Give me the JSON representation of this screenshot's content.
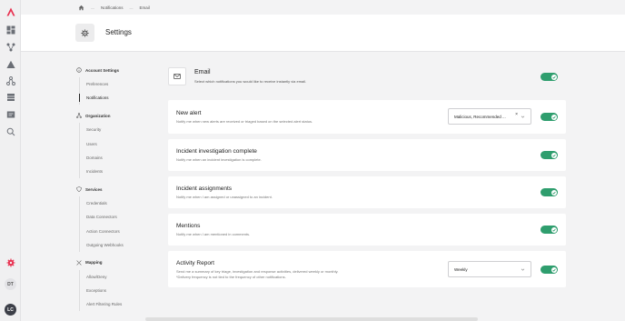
{
  "breadcrumb": {
    "home_icon": "home-icon",
    "items": [
      "Notifications",
      "Email"
    ]
  },
  "header": {
    "icon": "gear-icon",
    "title": "Settings"
  },
  "rail": {
    "icons": [
      "logo-icon",
      "dashboard-icon",
      "network-icon",
      "alert-icon",
      "graph-icon",
      "table-icon",
      "document-icon",
      "search-icon",
      "settings-icon"
    ],
    "avatars": [
      "DT",
      "LC"
    ],
    "accent": "#e8304f"
  },
  "nav": {
    "groups": [
      {
        "icon": "info-icon",
        "label": "Account Settings",
        "items": [
          "Preferences",
          "Notifications"
        ]
      },
      {
        "icon": "organization-icon",
        "label": "Organization",
        "items": [
          "Security",
          "Users",
          "Domains",
          "Incidents"
        ]
      },
      {
        "icon": "shield-icon",
        "label": "Services",
        "items": [
          "Credentials",
          "Data Connectors",
          "Action Connectors",
          "Outgoing Webhooks"
        ]
      },
      {
        "icon": "mapping-icon",
        "label": "Mapping",
        "items": [
          "Allow/Deny",
          "Exceptions",
          "Alert Filtering Rules"
        ]
      }
    ],
    "active": "Notifications"
  },
  "email": {
    "icon": "mail-icon",
    "title": "Email",
    "description": "Select which notifications you would like to receive instantly via email.",
    "enabled": true
  },
  "cards": [
    {
      "title": "New alert",
      "description": "Notify me when new alerts are received or triaged based on the selected alert status.",
      "select_value": "Malicious, Recommended ...",
      "enabled": true
    },
    {
      "title": "Incident investigation complete",
      "description": "Notify me when an incident investigation is complete.",
      "enabled": true
    },
    {
      "title": "Incident assignments",
      "description": "Notify me when I am assigned or unassigned to an incident.",
      "enabled": true
    },
    {
      "title": "Mentions",
      "description": "Notify me when I am mentioned in comments.",
      "enabled": true
    },
    {
      "title": "Activity Report",
      "description": "Send me a summary of key triage, investigation and response activities, delivered weekly or monthly.",
      "description2": "*Delivery frequency is not tied to the frequency of other notifications.",
      "select_value": "Weekly",
      "enabled": true
    }
  ],
  "colors": {
    "toggle_on": "#2f9e6e",
    "background": "#f3f3f4"
  }
}
